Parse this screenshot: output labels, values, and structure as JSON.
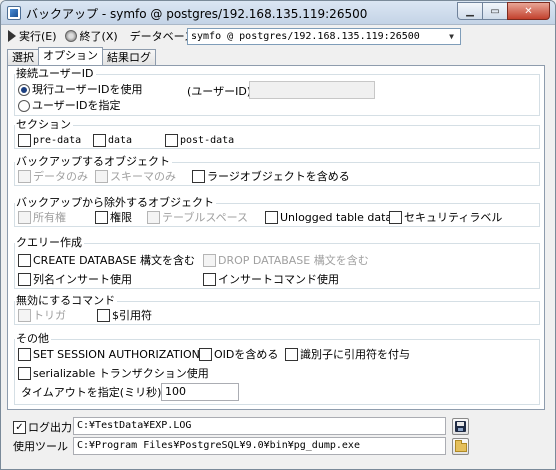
{
  "window": {
    "title": "バックアップ - symfo @ postgres/192.168.135.119:26500",
    "minimize_glyph": "▁",
    "maximize_glyph": "▭",
    "close_glyph": "✕"
  },
  "toolbar": {
    "run_label": "実行(E)",
    "exit_label": "終了(X)",
    "database_label": "データベース",
    "database_value": "symfo @ postgres/192.168.135.119:26500",
    "dropdown_glyph": "▼"
  },
  "tabs": [
    "選択",
    "オプション",
    "結果ログ"
  ],
  "connection_user": {
    "title": "接続ユーザーID",
    "use_current": "現行ユーザーIDを使用",
    "specify": "ユーザーIDを指定",
    "user_id_label": "(ユーザーID)",
    "user_id_value": "",
    "selected": "use_current"
  },
  "section": {
    "title": "セクション",
    "items": [
      "pre-data",
      "data",
      "post-data"
    ]
  },
  "backup_objects": {
    "title": "バックアップするオブジェクト",
    "items": [
      "データのみ",
      "スキーマのみ",
      "ラージオブジェクトを含める"
    ]
  },
  "exclude_objects": {
    "title": "バックアップから除外するオブジェクト",
    "items": [
      "所有権",
      "権限",
      "テーブルスペース",
      "Unlogged table data",
      "セキュリティラベル"
    ]
  },
  "query": {
    "title": "クエリー作成",
    "items": [
      "CREATE DATABASE 構文を含む",
      "DROP DATABASE 構文を含む",
      "列名インサート使用",
      "インサートコマンド使用"
    ]
  },
  "disable_commands": {
    "title": "無効にするコマンド",
    "items": [
      "トリガ",
      "$引用符"
    ]
  },
  "other": {
    "title": "その他",
    "items": [
      "SET SESSION AUTHORIZATION",
      "OIDを含める",
      "識別子に引用符を付与",
      "serializable トランザクション使用"
    ],
    "timeout_label": "タイムアウトを指定(ミリ秒)",
    "timeout_value": "100"
  },
  "log_output": {
    "label": "ログ出力",
    "checked_glyph": "✓",
    "value": "C:¥TestData¥EXP.LOG"
  },
  "tool": {
    "label": "使用ツール",
    "value": "C:¥Program Files¥PostgreSQL¥9.0¥bin¥pg_dump.exe"
  }
}
